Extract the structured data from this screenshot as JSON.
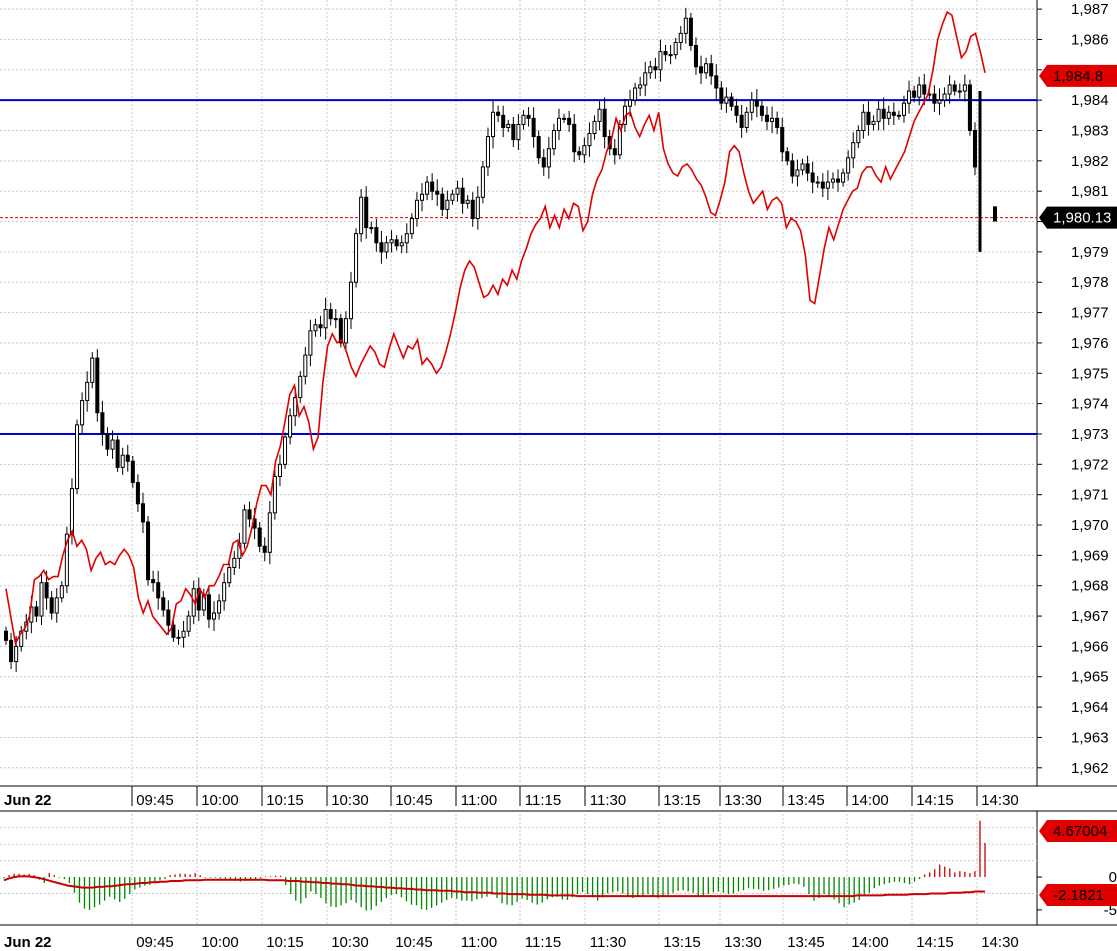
{
  "chart_data": [
    {
      "type": "candlestick",
      "y_ticks": [
        "1,987",
        "1,986",
        "1,985",
        "1,984",
        "1,983",
        "1,982",
        "1,981",
        "1,980",
        "1,979",
        "1,978",
        "1,977",
        "1,976",
        "1,975",
        "1,974",
        "1,973",
        "1,972",
        "1,971",
        "1,970",
        "1,969",
        "1,968",
        "1,967",
        "1,966",
        "1,965",
        "1,964",
        "1,963",
        "1,962"
      ],
      "x_ticks": [
        "Jun 22",
        "09:45",
        "10:00",
        "10:15",
        "10:30",
        "10:45",
        "11:00",
        "11:15",
        "11:30",
        "13:15",
        "13:30",
        "13:45",
        "14:00",
        "14:15",
        "14:30"
      ],
      "ylim": [
        1961.4,
        1987.3
      ],
      "horizontal_lines": [
        1984.0,
        1973.0
      ],
      "last_price_line": 1980.13,
      "tags": {
        "red_line_value": "1,984.8",
        "last_price": "1,980.13"
      },
      "colors": {
        "candle": "#000000",
        "red_series": "#e00000",
        "level_lines": "#0000dd",
        "last_price": "#e00000"
      },
      "grid": true,
      "candle_closes": [
        1966.2,
        1965.5,
        1966.0,
        1966.5,
        1966.8,
        1967.3,
        1967.0,
        1968.1,
        1967.6,
        1967.1,
        1967.6,
        1968.0,
        1969.7,
        1971.2,
        1973.3,
        1974.1,
        1974.7,
        1975.5,
        1973.7,
        1973.0,
        1972.5,
        1972.8,
        1971.9,
        1972.3,
        1972.1,
        1971.4,
        1970.7,
        1970.1,
        1968.2,
        1968.1,
        1967.6,
        1967.2,
        1966.7,
        1966.3,
        1966.3,
        1966.5,
        1967.0,
        1967.9,
        1967.2,
        1967.7,
        1966.9,
        1967.1,
        1967.5,
        1968.1,
        1968.6,
        1968.9,
        1969.4,
        1970.5,
        1970.2,
        1969.9,
        1969.3,
        1969.1,
        1970.4,
        1971.6,
        1972.0,
        1972.9,
        1973.6,
        1974.2,
        1974.9,
        1975.6,
        1976.4,
        1976.6,
        1976.5,
        1977.1,
        1976.8,
        1976.8,
        1976.0,
        1976.8,
        1978.0,
        1979.6,
        1980.8,
        1979.8,
        1979.8,
        1979.3,
        1979.0,
        1979.3,
        1979.4,
        1979.2,
        1979.3,
        1979.6,
        1980.1,
        1980.7,
        1980.9,
        1981.3,
        1981.0,
        1980.9,
        1980.4,
        1980.7,
        1980.9,
        1981.1,
        1980.6,
        1980.7,
        1980.1,
        1980.8,
        1981.8,
        1982.8,
        1983.6,
        1983.5,
        1983.1,
        1983.2,
        1982.7,
        1983.2,
        1983.5,
        1983.4,
        1982.8,
        1982.1,
        1981.8,
        1982.4,
        1983.0,
        1983.4,
        1983.4,
        1983.2,
        1982.3,
        1982.2,
        1982.5,
        1982.9,
        1983.3,
        1983.7,
        1982.8,
        1982.4,
        1982.2,
        1983.2,
        1983.8,
        1984.0,
        1984.4,
        1984.5,
        1984.9,
        1985.1,
        1985.0,
        1985.6,
        1985.5,
        1985.5,
        1985.9,
        1986.2,
        1986.7,
        1985.8,
        1985.1,
        1984.9,
        1985.2,
        1984.8,
        1984.4,
        1983.9,
        1984.1,
        1983.8,
        1983.5,
        1983.1,
        1983.6,
        1984.0,
        1983.8,
        1983.5,
        1983.3,
        1983.4,
        1983.1,
        1982.3,
        1982.0,
        1981.5,
        1981.7,
        1981.9,
        1981.6,
        1981.3,
        1981.3,
        1981.1,
        1981.3,
        1981.4,
        1981.3,
        1981.6,
        1982.1,
        1982.6,
        1983.0,
        1983.6,
        1983.2,
        1983.3,
        1983.7,
        1983.4,
        1983.6,
        1983.5,
        1983.5,
        1983.9,
        1984.3,
        1984.1,
        1984.5,
        1984.2,
        1984.2,
        1983.9,
        1984.0,
        1984.2,
        1984.5,
        1984.3,
        1984.3,
        1984.5,
        1983.0,
        1981.8
      ],
      "red_series": [
        1967.9,
        1967.0,
        1966.1,
        1966.4,
        1966.6,
        1967.0,
        1968.2,
        1968.3,
        1968.5,
        1968.2,
        1968.3,
        1968.3,
        1969.0,
        1969.5,
        1969.8,
        1969.3,
        1969.5,
        1969.2,
        1968.5,
        1968.9,
        1969.1,
        1968.7,
        1968.8,
        1968.7,
        1969.0,
        1969.2,
        1969.0,
        1968.6,
        1967.6,
        1967.1,
        1967.5,
        1967.0,
        1966.8,
        1966.6,
        1966.4,
        1966.6,
        1967.4,
        1967.5,
        1967.9,
        1967.7,
        1967.4,
        1967.9,
        1967.6,
        1968.0,
        1968.0,
        1968.3,
        1968.7,
        1968.7,
        1969.4,
        1969.5,
        1969.0,
        1969.3,
        1969.9,
        1970.7,
        1971.3,
        1971.3,
        1971.0,
        1972.1,
        1972.6,
        1973.4,
        1974.3,
        1974.6,
        1973.6,
        1973.9,
        1973.4,
        1972.5,
        1972.9,
        1974.7,
        1975.9,
        1976.3,
        1976.0,
        1976.1,
        1975.7,
        1975.2,
        1974.9,
        1975.3,
        1975.6,
        1975.9,
        1975.7,
        1975.3,
        1975.2,
        1975.8,
        1976.3,
        1975.9,
        1975.5,
        1975.9,
        1975.8,
        1976.1,
        1975.3,
        1975.5,
        1975.3,
        1975.0,
        1975.2,
        1975.7,
        1976.3,
        1977.0,
        1977.8,
        1978.4,
        1978.7,
        1978.5,
        1978.0,
        1977.5,
        1977.6,
        1977.9,
        1977.6,
        1978.1,
        1977.9,
        1978.4,
        1978.1,
        1978.7,
        1979.1,
        1979.6,
        1979.9,
        1980.1,
        1980.5,
        1979.8,
        1980.2,
        1979.8,
        1980.4,
        1980.1,
        1980.6,
        1980.5,
        1979.7,
        1980.0,
        1980.9,
        1981.4,
        1981.7,
        1982.3,
        1982.7,
        1983.4,
        1983.0,
        1983.5,
        1983.6,
        1983.1,
        1982.8,
        1983.2,
        1983.5,
        1983.0,
        1983.6,
        1982.4,
        1981.9,
        1981.6,
        1981.5,
        1981.8,
        1981.9,
        1981.7,
        1981.4,
        1981.2,
        1980.8,
        1980.3,
        1980.2,
        1980.7,
        1981.3,
        1982.3,
        1982.5,
        1982.3,
        1981.6,
        1981.0,
        1980.6,
        1980.8,
        1981.0,
        1980.4,
        1980.7,
        1980.8,
        1980.6,
        1979.8,
        1980.1,
        1980.0,
        1979.7,
        1978.9,
        1977.4,
        1977.3,
        1978.2,
        1979.1,
        1979.8,
        1979.4,
        1979.9,
        1980.4,
        1980.7,
        1981.0,
        1981.1,
        1981.6,
        1981.8,
        1981.8,
        1981.5,
        1981.3,
        1981.8,
        1981.4,
        1981.7,
        1982.0,
        1982.3,
        1982.8,
        1983.3,
        1983.6,
        1983.9,
        1984.2,
        1985.0,
        1986.0,
        1986.5,
        1986.9,
        1986.8,
        1986.1,
        1985.4,
        1985.6,
        1986.1,
        1986.2,
        1985.6,
        1984.9
      ],
      "gaps_after_index": [
        91,
        100
      ],
      "last_bar": {
        "high": 1984.3,
        "low": 1979.0,
        "close": 1980.13
      }
    },
    {
      "type": "bar",
      "panel": "oscillator",
      "y_ticks": [
        "0",
        "-5"
      ],
      "ylim": [
        -7.3,
        9.6
      ],
      "tags": {
        "histogram": "4.67004",
        "signal": "-2.1821"
      },
      "colors": {
        "positive": "#cc0000",
        "negative": "#008800",
        "signal": "#cc0000"
      },
      "histogram": [
        -0.2,
        0.3,
        0.5,
        0.5,
        0.4,
        0.5,
        0.3,
        -0.4,
        -0.9,
        0.6,
        0.3,
        -0.1,
        -0.3,
        -0.9,
        -2.4,
        -3.9,
        -4.8,
        -5.0,
        -4.6,
        -4.2,
        -3.6,
        -3.0,
        -3.4,
        -3.8,
        -3.3,
        -2.6,
        -1.9,
        -1.6,
        -1.3,
        -1.2,
        -0.9,
        -0.5,
        -0.3,
        0.3,
        0.4,
        0.5,
        0.5,
        0.4,
        0.6,
        0.3,
        -0.1,
        -0.1,
        -0.1,
        -0.2,
        -0.3,
        -0.5,
        -0.6,
        -0.7,
        -0.6,
        -0.5,
        -0.3,
        -0.2,
        0.1,
        0.1,
        0.2,
        0.2,
        -1.2,
        -2.6,
        -3.6,
        -4.0,
        -3.2,
        -2.2,
        -2.6,
        -3.2,
        -4.0,
        -4.5,
        -4.6,
        -4.3,
        -4.0,
        -3.5,
        -3.9,
        -4.6,
        -5.1,
        -5.0,
        -4.4,
        -3.8,
        -3.2,
        -2.7,
        -2.6,
        -3.1,
        -3.7,
        -4.2,
        -4.3,
        -4.9,
        -5.0,
        -4.7,
        -4.3,
        -3.9,
        -3.5,
        -3.2,
        -3.3,
        -3.6,
        -3.6,
        -3.7,
        -3.4,
        -3.2,
        -3.0,
        -2.7,
        -3.2,
        -4.0,
        -4.2,
        -4.3,
        -3.8,
        -3.3,
        -3.5,
        -3.9,
        -4.2,
        -3.9,
        -3.4,
        -3.1,
        -3.0,
        -3.4,
        -3.5,
        -3.1,
        -2.6,
        -2.3,
        -2.6,
        -3.1,
        -3.6,
        -3.1,
        -2.5,
        -2.3,
        -2.2,
        -2.5,
        -2.9,
        -3.2,
        -3.0,
        -2.8,
        -2.6,
        -2.8,
        -3.2,
        -3.0,
        -2.7,
        -2.4,
        -2.1,
        -2.0,
        -2.2,
        -2.4,
        -3.0,
        -2.9,
        -2.6,
        -2.3,
        -2.2,
        -2.4,
        -2.6,
        -2.5,
        -2.2,
        -2.0,
        -1.7,
        -1.8,
        -1.9,
        -2.1,
        -2.0,
        -1.8,
        -1.6,
        -1.3,
        -1.2,
        -1.0,
        -1.1,
        -1.5,
        -2.6,
        -3.6,
        -3.2,
        -2.6,
        -2.8,
        -3.4,
        -4.0,
        -4.6,
        -4.2,
        -3.9,
        -3.5,
        -2.8,
        -2.4,
        -1.7,
        -1.3,
        -1.1,
        -0.9,
        -0.7,
        -0.7,
        -0.9,
        -1.1,
        -0.7,
        -0.3,
        0.4,
        0.7,
        1.2,
        1.9,
        1.6,
        1.3,
        0.7,
        0.9,
        0.8,
        0.6,
        0.9,
        8.6,
        5.2
      ],
      "signal": [
        -0.5,
        -0.2,
        0.0,
        0.1,
        0.1,
        0.1,
        0.0,
        -0.1,
        -0.3,
        -0.5,
        -0.7,
        -0.9,
        -1.1,
        -1.3,
        -1.4,
        -1.5,
        -1.6,
        -1.6,
        -1.6,
        -1.5,
        -1.5,
        -1.4,
        -1.4,
        -1.3,
        -1.2,
        -1.1,
        -1.1,
        -1.0,
        -0.9,
        -0.9,
        -0.8,
        -0.8,
        -0.7,
        -0.7,
        -0.6,
        -0.6,
        -0.6,
        -0.5,
        -0.5,
        -0.5,
        -0.5,
        -0.4,
        -0.4,
        -0.4,
        -0.4,
        -0.4,
        -0.4,
        -0.4,
        -0.4,
        -0.4,
        -0.4,
        -0.4,
        -0.4,
        -0.4,
        -0.5,
        -0.5,
        -0.5,
        -0.5,
        -0.6,
        -0.6,
        -0.6,
        -0.7,
        -0.7,
        -0.8,
        -0.8,
        -0.9,
        -0.9,
        -1.0,
        -1.0,
        -1.1,
        -1.1,
        -1.2,
        -1.3,
        -1.3,
        -1.4,
        -1.4,
        -1.5,
        -1.5,
        -1.6,
        -1.6,
        -1.7,
        -1.7,
        -1.8,
        -1.8,
        -1.9,
        -1.9,
        -2.0,
        -2.0,
        -2.0,
        -2.1,
        -2.1,
        -2.1,
        -2.2,
        -2.2,
        -2.3,
        -2.3,
        -2.3,
        -2.4,
        -2.4,
        -2.4,
        -2.5,
        -2.5,
        -2.5,
        -2.6,
        -2.6,
        -2.6,
        -2.6,
        -2.7,
        -2.7,
        -2.7,
        -2.7,
        -2.8,
        -2.8,
        -2.8,
        -2.8,
        -2.8,
        -2.8,
        -2.9,
        -2.9,
        -2.9,
        -2.9,
        -2.9,
        -2.9,
        -2.9,
        -2.9,
        -2.9,
        -2.9,
        -2.9,
        -2.9,
        -2.9,
        -2.9,
        -2.9,
        -2.9,
        -2.9,
        -2.9,
        -2.9,
        -2.9,
        -2.9,
        -2.9,
        -2.9,
        -2.9,
        -2.9,
        -2.9,
        -2.9,
        -2.9,
        -2.9,
        -2.9,
        -2.9,
        -2.9,
        -2.9,
        -2.9,
        -2.9,
        -2.9,
        -2.9,
        -2.9,
        -2.9,
        -2.9,
        -2.9,
        -2.9,
        -2.9,
        -2.9,
        -2.9,
        -2.9,
        -2.9,
        -2.9,
        -2.9,
        -2.9,
        -2.9,
        -2.9,
        -2.9,
        -2.9,
        -2.9,
        -2.9,
        -2.9,
        -2.8,
        -2.8,
        -2.8,
        -2.8,
        -2.8,
        -2.8,
        -2.7,
        -2.7,
        -2.7,
        -2.7,
        -2.7,
        -2.6,
        -2.6,
        -2.6,
        -2.6,
        -2.5,
        -2.5,
        -2.5,
        -2.5,
        -2.4,
        -2.4,
        -2.4,
        -2.3,
        -2.3,
        -2.2,
        -2.2,
        -2.2
      ]
    }
  ]
}
